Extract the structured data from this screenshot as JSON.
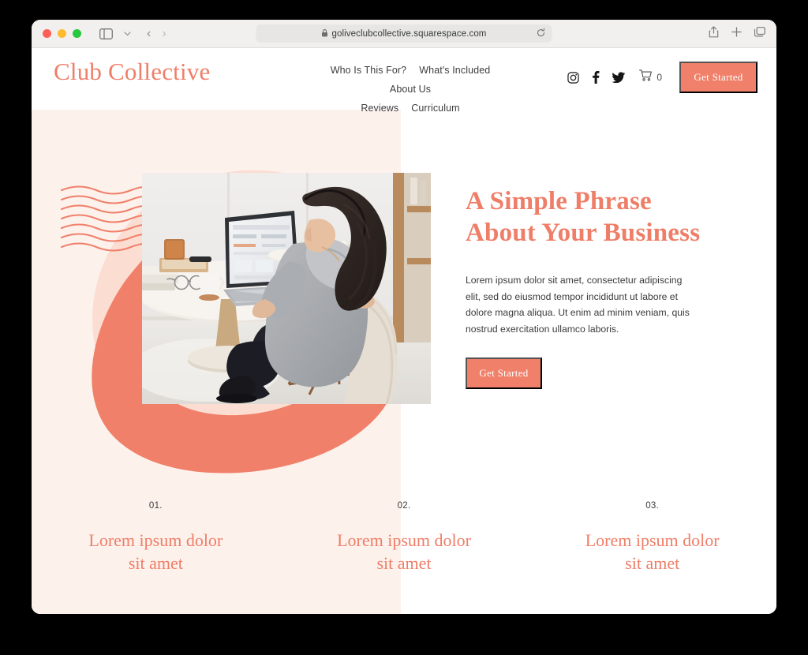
{
  "browser": {
    "url": "goliveclubcollective.squarespace.com",
    "lock_icon": "lock-icon",
    "reload_icon": "reload-icon",
    "sidebar_icon": "sidebar-toggle-icon",
    "chevron_icon": "chevron-down-icon",
    "back_arrow": "‹",
    "forward_arrow": "›",
    "share_icon": "share-icon",
    "new_tab_icon": "plus-icon",
    "tabs_icon": "tab-overview-icon",
    "traffic_lights": [
      "close",
      "minimize",
      "zoom"
    ]
  },
  "site": {
    "logo": "Club Collective",
    "nav": [
      {
        "label": "Who Is This For?"
      },
      {
        "label": "What's Included"
      },
      {
        "label": "About Us"
      },
      {
        "label": "Reviews"
      },
      {
        "label": "Curriculum"
      }
    ],
    "social": [
      {
        "name": "instagram-icon"
      },
      {
        "name": "facebook-icon"
      },
      {
        "name": "twitter-icon"
      }
    ],
    "cart": {
      "icon": "cart-icon",
      "count": "0"
    },
    "header_cta": "Get Started"
  },
  "hero": {
    "title_line1": "A Simple Phrase",
    "title_line2": "About Your Business",
    "body": "Lorem ipsum dolor sit amet, consectetur adipiscing elit, sed do eiusmod tempor incididunt ut labore et dolore magna aliqua. Ut enim ad minim veniam, quis nostrud exercitation ullamco laboris.",
    "cta": "Get Started",
    "photo_alt": "woman-working-at-laptop-photo"
  },
  "features": [
    {
      "number": "01.",
      "title": "Lorem ipsum dolor\nsit amet"
    },
    {
      "number": "02.",
      "title": "Lorem ipsum dolor\nsit amet"
    },
    {
      "number": "03.",
      "title": "Lorem ipsum dolor\nsit amet"
    }
  ],
  "colors": {
    "coral": "#f0806a",
    "coral_text": "#ef7e68",
    "pink_panel": "#fdf1ec",
    "pink_blob_light": "#fbddd2",
    "page_bg": "#ffffff",
    "backdrop": "#000000"
  }
}
